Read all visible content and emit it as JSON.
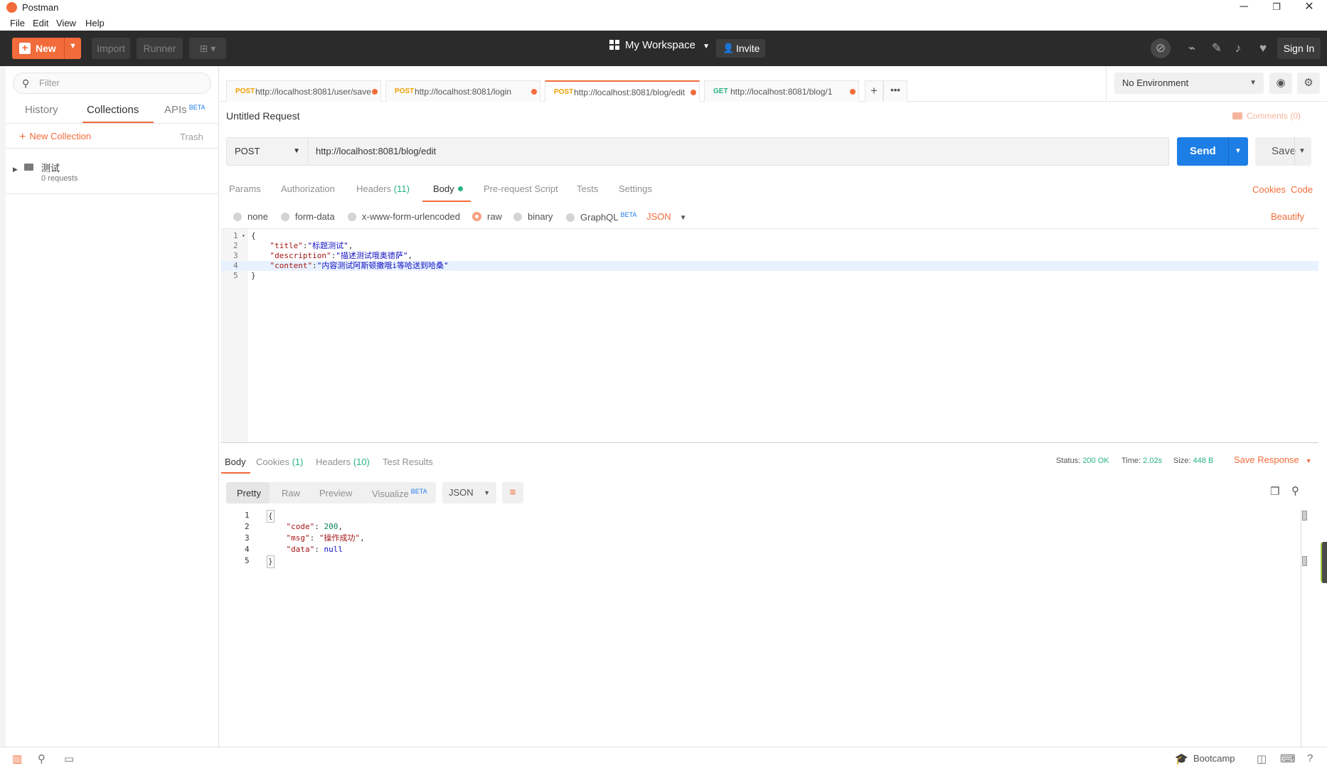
{
  "window": {
    "title": "Postman",
    "minimize": "─",
    "restore": "❐",
    "close": "✕"
  },
  "menu": [
    "File",
    "Edit",
    "View",
    "Help"
  ],
  "header": {
    "new_label": "New",
    "import_label": "Import",
    "runner_label": "Runner",
    "workspace_label": "My Workspace",
    "invite_label": "Invite",
    "signin_label": "Sign In"
  },
  "sidebar": {
    "filter_placeholder": "Filter",
    "tabs": {
      "history": "History",
      "collections": "Collections",
      "apis": "APIs",
      "apis_badge": "BETA"
    },
    "new_collection": "New Collection",
    "trash": "Trash",
    "collection": {
      "name": "测试",
      "count": "0 requests"
    }
  },
  "tabs": [
    {
      "method": "POST",
      "url": "http://localhost:8081/user/save"
    },
    {
      "method": "POST",
      "url": "http://localhost:8081/login"
    },
    {
      "method": "POST",
      "url": "http://localhost:8081/blog/edit"
    },
    {
      "method": "GET",
      "url": "http://localhost:8081/blog/1"
    }
  ],
  "environment": "No Environment",
  "request": {
    "title": "Untitled Request",
    "comments": "Comments (0)",
    "method": "POST",
    "url": "http://localhost:8081/blog/edit",
    "send": "Send",
    "save": "Save",
    "option_tabs": {
      "params": "Params",
      "authorization": "Authorization",
      "headers": "Headers",
      "headers_count": "(11)",
      "body": "Body",
      "prerequest": "Pre-request Script",
      "tests": "Tests",
      "settings": "Settings"
    },
    "cookies": "Cookies",
    "code": "Code",
    "body_types": {
      "none": "none",
      "form_data": "form-data",
      "urlencoded": "x-www-form-urlencoded",
      "raw": "raw",
      "binary": "binary",
      "graphql": "GraphQL",
      "graphql_badge": "BETA",
      "format": "JSON"
    },
    "beautify": "Beautify",
    "body_lines": [
      {
        "n": "1",
        "text": "{"
      },
      {
        "n": "2",
        "key": "\"title\"",
        "val": "\"标题测试\"",
        "end": ","
      },
      {
        "n": "3",
        "key": "\"description\"",
        "val": "\"描述测试哦奥德萨\"",
        "end": ","
      },
      {
        "n": "4",
        "key": "\"content\"",
        "val": "\"内容测试阿斯顿撒哦i等哈送到哈桑\"",
        "end": ""
      },
      {
        "n": "5",
        "text": "}"
      }
    ]
  },
  "response": {
    "tabs": {
      "body": "Body",
      "cookies": "Cookies",
      "cookies_count": "(1)",
      "headers": "Headers",
      "headers_count": "(10)",
      "tests": "Test Results"
    },
    "status_label": "Status:",
    "status_value": "200 OK",
    "time_label": "Time:",
    "time_value": "2.02s",
    "size_label": "Size:",
    "size_value": "448 B",
    "save_response": "Save Response",
    "views": {
      "pretty": "Pretty",
      "raw": "Raw",
      "preview": "Preview",
      "visualize": "Visualize",
      "visualize_badge": "BETA"
    },
    "format": "JSON",
    "lines": [
      {
        "n": "1",
        "text": "{"
      },
      {
        "n": "2",
        "key": "\"code\"",
        "val": "200",
        "end": ","
      },
      {
        "n": "3",
        "key": "\"msg\"",
        "val": "\"操作成功\"",
        "end": ","
      },
      {
        "n": "4",
        "key": "\"data\"",
        "val": "null",
        "end": ""
      },
      {
        "n": "5",
        "text": "}"
      }
    ]
  },
  "footer": {
    "bootcamp": "Bootcamp"
  },
  "colors": {
    "accent": "#f26b3a",
    "send": "#1d7ee6",
    "status_green": "#26b47f",
    "header_bg": "#2b2b2b"
  },
  "icons": [
    "search-icon",
    "sync-off-icon",
    "satellite-icon",
    "notification-bell-icon",
    "heart-icon",
    "eye-icon",
    "gear-icon",
    "copy-icon",
    "wrap-icon",
    "folder-icon"
  ]
}
